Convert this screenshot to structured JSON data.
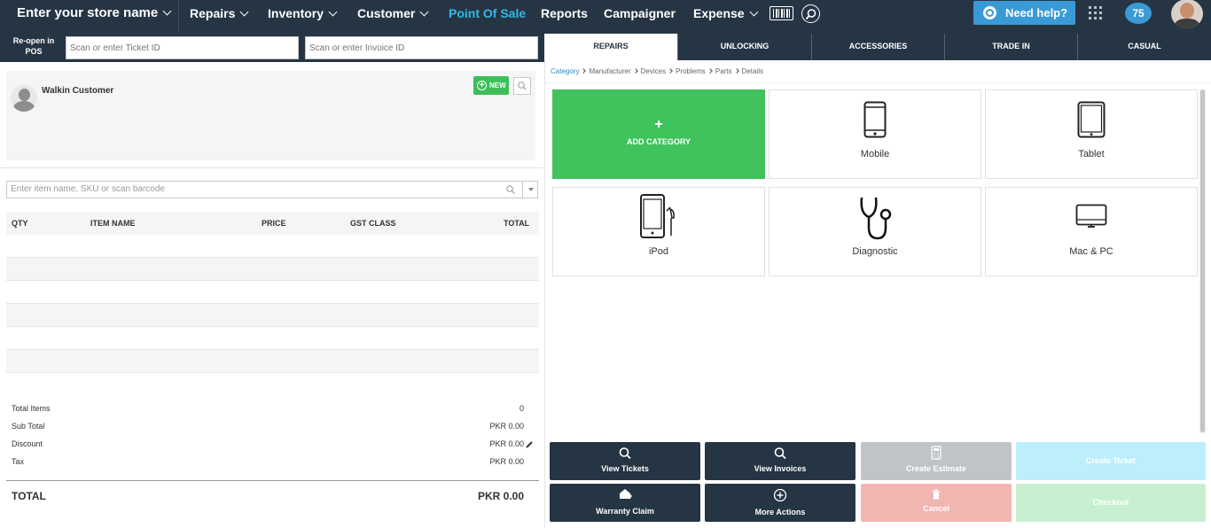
{
  "topnav": {
    "store": "Enter your store name",
    "items": [
      "Repairs",
      "Inventory",
      "Customer",
      "Point Of Sale",
      "Reports",
      "Campaigner",
      "Expense"
    ],
    "help": "Need help?",
    "badge": "75"
  },
  "leftbar": {
    "reopen": "Re-open in POS",
    "ticket_placeholder": "Scan or enter Ticket ID",
    "invoice_placeholder": "Scan or enter Invoice ID"
  },
  "customer": {
    "name": "Walkin Customer",
    "new_label": "NEW"
  },
  "item_search": {
    "placeholder": "Enter item name, SKU or scan barcode"
  },
  "table": {
    "headers": [
      "QTY",
      "ITEM NAME",
      "PRICE",
      "GST CLASS",
      "TOTAL"
    ]
  },
  "summary": {
    "total_items_label": "Total Items",
    "total_items": "0",
    "subtotal_label": "Sub Total",
    "subtotal": "PKR 0.00",
    "discount_label": "Discount",
    "discount": "PKR 0.00",
    "tax_label": "Tax",
    "tax": "PKR 0.00",
    "total_label": "TOTAL",
    "total": "PKR 0.00"
  },
  "tabs": [
    "REPAIRS",
    "UNLOCKING",
    "ACCESSORIES",
    "TRADE IN",
    "CASUAL"
  ],
  "breadcrumb": [
    "Category",
    "Manufacturer",
    "Devices",
    "Problems",
    "Parts",
    "Details"
  ],
  "tiles": {
    "add_plus": "+",
    "add": "ADD CATEGORY",
    "mobile": "Mobile",
    "tablet": "Tablet",
    "ipod": "iPod",
    "diagnostic": "Diagnostic",
    "mac": "Mac & PC"
  },
  "actions": {
    "view_tickets": "View Tickets",
    "view_invoices": "View Invoices",
    "create_estimate": "Create Estimate",
    "create_ticket": "Create Ticket",
    "warranty_claim": "Warranty Claim",
    "more_actions": "More Actions",
    "cancel": "Cancel",
    "checkout": "Checkout"
  },
  "colors": {
    "nav": "#263544",
    "accent": "#33b8e8",
    "green": "#40c25d",
    "help": "#3a9ad6"
  }
}
